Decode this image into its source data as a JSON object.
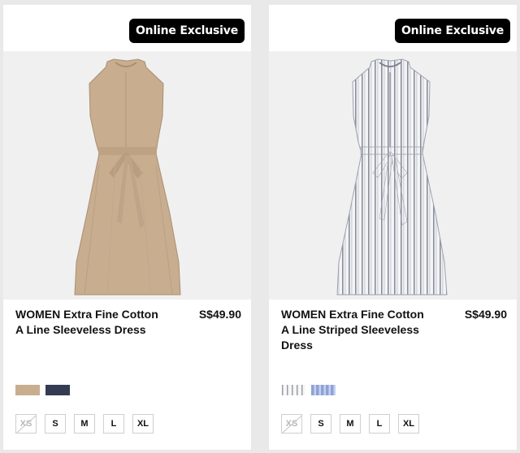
{
  "products": [
    {
      "badge": "Online Exclusive",
      "title": "WOMEN Extra Fine Cotton A Line Sleeveless Dress",
      "price": "S$49.90",
      "image": "beige-sleeveless-dress",
      "colors": [
        "#c9ad8f",
        "#353c52"
      ],
      "sizes": [
        {
          "label": "XS",
          "available": false
        },
        {
          "label": "S",
          "available": true
        },
        {
          "label": "M",
          "available": true
        },
        {
          "label": "L",
          "available": true
        },
        {
          "label": "XL",
          "available": true
        }
      ]
    },
    {
      "badge": "Online Exclusive",
      "title": "WOMEN Extra Fine Cotton A Line Striped Sleeveless Dress",
      "price": "S$49.90",
      "image": "striped-sleeveless-dress",
      "colors": [
        "grey-white-stripe",
        "#93a6d8"
      ],
      "sizes": [
        {
          "label": "XS",
          "available": false
        },
        {
          "label": "S",
          "available": true
        },
        {
          "label": "M",
          "available": true
        },
        {
          "label": "L",
          "available": true
        },
        {
          "label": "XL",
          "available": true
        }
      ]
    }
  ]
}
